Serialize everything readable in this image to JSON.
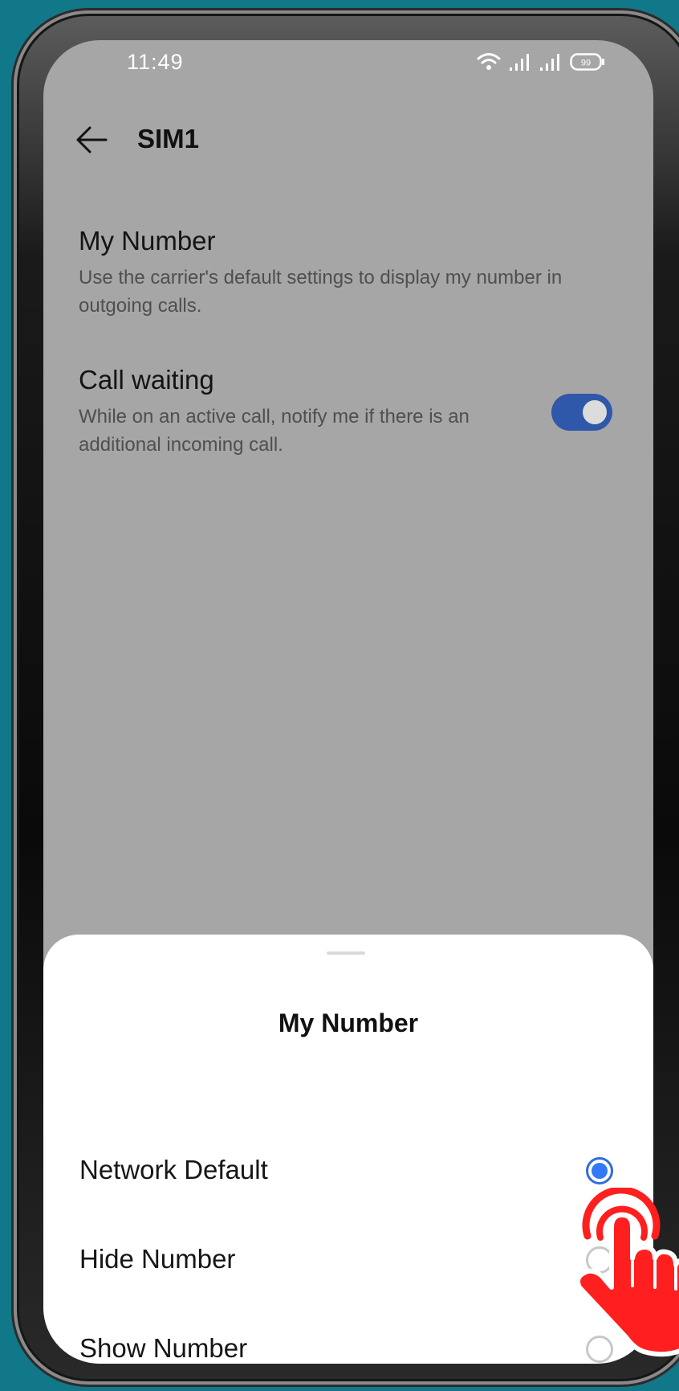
{
  "status_bar": {
    "time": "11:49",
    "battery": "99"
  },
  "header": {
    "title": "SIM1"
  },
  "settings": {
    "my_number": {
      "title": "My Number",
      "description": "Use the carrier's default settings to display my number in outgoing calls."
    },
    "call_waiting": {
      "title": "Call waiting",
      "description": "While on an active call, notify me if there is an additional incoming call.",
      "enabled": true
    }
  },
  "sheet": {
    "title": "My Number",
    "options": [
      {
        "label": "Network Default",
        "selected": true
      },
      {
        "label": "Hide Number",
        "selected": false
      },
      {
        "label": "Show Number",
        "selected": false
      }
    ]
  },
  "colors": {
    "accent": "#3478f6",
    "toggle_on": "#2f57aa",
    "dim_overlay": "#a6a6a6",
    "background": "#117889",
    "tap_indicator": "#ff1f1f"
  },
  "icons": [
    "back-arrow-icon",
    "wifi-icon",
    "signal-icon",
    "battery-icon",
    "tap-hand-icon"
  ]
}
